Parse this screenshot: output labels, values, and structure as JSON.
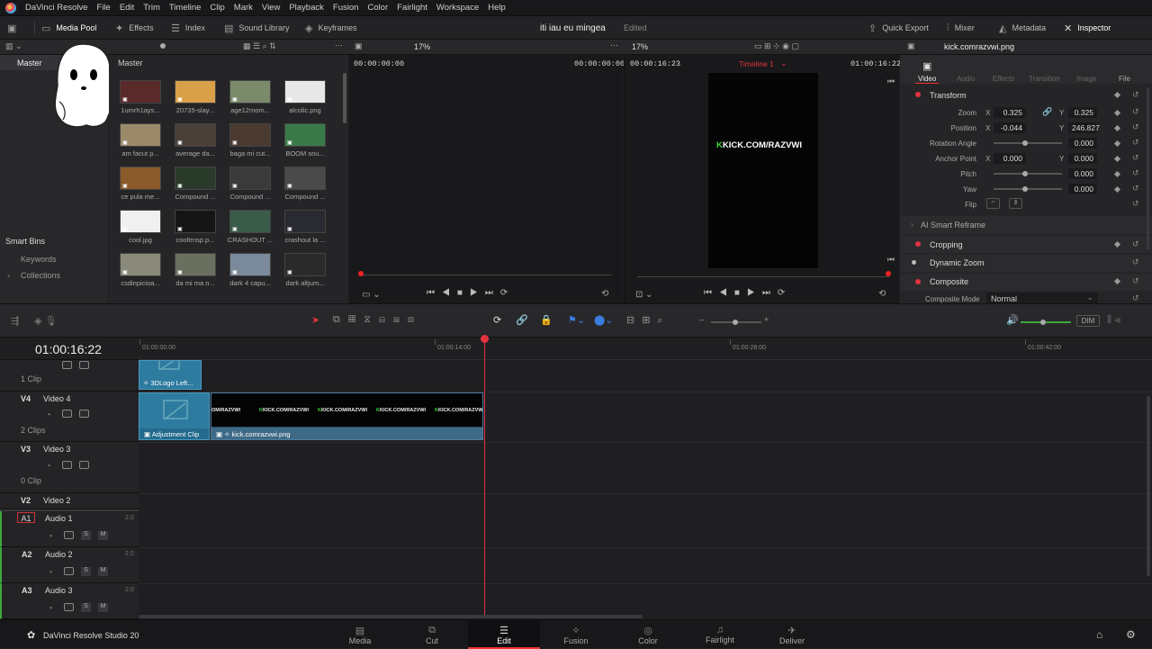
{
  "menubar": {
    "app_name": "DaVinci Resolve",
    "items": [
      "File",
      "Edit",
      "Trim",
      "Timeline",
      "Clip",
      "Mark",
      "View",
      "Playback",
      "Fusion",
      "Color",
      "Fairlight",
      "Workspace",
      "Help"
    ]
  },
  "toolbar": {
    "media_pool": "Media Pool",
    "effects": "Effects",
    "index": "Index",
    "sound_library": "Sound Library",
    "keyframes": "Keyframes",
    "project_title": "iti iau eu mingea",
    "project_status": "Edited",
    "quick_export": "Quick Export",
    "mixer": "Mixer",
    "metadata": "Metadata",
    "inspector": "Inspector"
  },
  "media_pool": {
    "bin_root": "Master",
    "bin_path": "Master",
    "smart_bins": "Smart Bins",
    "keywords": "Keywords",
    "collections": "Collections",
    "clips": [
      {
        "name": "1umrh1ays...",
        "color": "#5a2a2a"
      },
      {
        "name": "20735-slay...",
        "color": "#d9a04a"
      },
      {
        "name": "age12mom...",
        "color": "#7a8a6a"
      },
      {
        "name": "alcolic.png",
        "color": "#e8e8e8"
      },
      {
        "name": "am facut p...",
        "color": "#9a8a6a"
      },
      {
        "name": "average da...",
        "color": "#4a4038"
      },
      {
        "name": "baga mi cut...",
        "color": "#4a3a30"
      },
      {
        "name": "BOOM sou...",
        "color": "#3a7a4a"
      },
      {
        "name": "ce pula me...",
        "color": "#8a5a2a"
      },
      {
        "name": "Compound ...",
        "color": "#2a3a2a"
      },
      {
        "name": "Compound ...",
        "color": "#3a3a3a"
      },
      {
        "name": "Compound ...",
        "color": "#4a4a4a"
      },
      {
        "name": "cool.jpg",
        "color": "#f0f0f0"
      },
      {
        "name": "cooltrnsp.p...",
        "color": "#151515"
      },
      {
        "name": "CRASHOUT ...",
        "color": "#3a5a4a"
      },
      {
        "name": "crashout la ...",
        "color": "#2a2a32"
      },
      {
        "name": "csdinpicioa...",
        "color": "#8a8a7a"
      },
      {
        "name": "da mi ma n...",
        "color": "#6a7060"
      },
      {
        "name": "dark 4 capu...",
        "color": "#7a8a9a"
      },
      {
        "name": "dark altjum...",
        "color": "#2a2a2a"
      }
    ]
  },
  "source_viewer": {
    "zoom": "17%",
    "tc_in": "00:00:00:00",
    "tc_out": "00:00:00:00"
  },
  "timeline_viewer": {
    "zoom": "17%",
    "duration": "00:00:16:23",
    "timeline_name": "Timeline 1",
    "timecode": "01:00:16:22",
    "overlay_text": "KICK.COM/RAZVWI"
  },
  "inspector": {
    "clip_name": "kick.comrazvwi.png",
    "tabs": [
      "Video",
      "Audio",
      "Effects",
      "Transition",
      "Image",
      "File"
    ],
    "transform": "Transform",
    "zoom_label": "Zoom",
    "zoom_x": "0.325",
    "zoom_y": "0.325",
    "position_label": "Position",
    "position_x": "-0.044",
    "position_y": "246.827",
    "rotation_label": "Rotation Angle",
    "rotation": "0.000",
    "anchor_label": "Anchor Point",
    "anchor_x": "0.000",
    "anchor_y": "0.000",
    "pitch_label": "Pitch",
    "pitch": "0.000",
    "yaw_label": "Yaw",
    "yaw": "0.000",
    "flip_label": "Flip",
    "ai_reframe": "AI Smart Reframe",
    "cropping": "Cropping",
    "dynamic_zoom": "Dynamic Zoom",
    "composite": "Composite",
    "composite_mode_label": "Composite Mode",
    "composite_mode": "Normal",
    "x_label": "X",
    "y_label": "Y"
  },
  "timeline": {
    "timecode": "01:00:16:22",
    "ruler": [
      "01:00:00:00",
      "01:00:14:00",
      "01:00:28:00",
      "01:00:42:00"
    ],
    "dim": "DIM",
    "tracks": [
      {
        "id": "",
        "name": "",
        "clips": "1 Clip"
      },
      {
        "id": "V4",
        "name": "Video 4",
        "clips": "2 Clips"
      },
      {
        "id": "V3",
        "name": "Video 3",
        "clips": "0 Clip"
      },
      {
        "id": "V2",
        "name": "Video 2",
        "clips": ""
      },
      {
        "id": "A1",
        "name": "Audio 1",
        "level": "2.0"
      },
      {
        "id": "A2",
        "name": "Audio 2",
        "level": "2.0"
      },
      {
        "id": "A3",
        "name": "Audio 3",
        "level": "2.0"
      }
    ],
    "clip_3dlogo": "3DLogo Left...",
    "clip_adjustment": "Adjustment Clip",
    "clip_kick": "kick.comrazvwi.png",
    "solo": "S",
    "mute": "M"
  },
  "pages": {
    "brand": "DaVinci Resolve Studio 20",
    "items": [
      "Media",
      "Cut",
      "Edit",
      "Fusion",
      "Color",
      "Fairlight",
      "Deliver"
    ],
    "active": "Edit"
  }
}
